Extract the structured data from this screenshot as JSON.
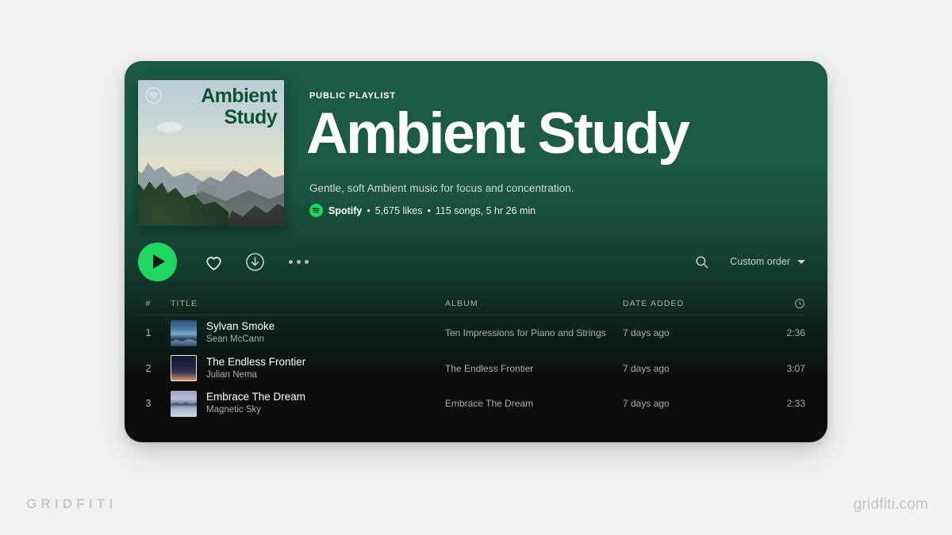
{
  "branding": {
    "left_mark": "GRIDFITI",
    "right_mark": "gridfiti.com"
  },
  "colors": {
    "page_background": "#f2f2f2",
    "header_green": "#1d5a45",
    "body_black": "#0c0c0c",
    "spotify_green": "#1ed760",
    "cover_title_green": "#0f5132"
  },
  "cover": {
    "title_line1": "Ambient",
    "title_line2": "Study",
    "spotify_badge_icon": "spotify-logo-icon",
    "artwork_description": "mountain-landscape-photo"
  },
  "header": {
    "kicker": "PUBLIC PLAYLIST",
    "title": "Ambient Study",
    "description": "Gentle, soft Ambient music for focus and concentration.",
    "owner_icon": "spotify-logo-icon",
    "owner": "Spotify",
    "likes": "5,675 likes",
    "songs_and_duration": "115 songs, 5 hr 26 min",
    "separator": "•"
  },
  "controls": {
    "play_icon": "play-icon",
    "like_icon": "heart-icon",
    "download_icon": "download-circle-icon",
    "more_icon": "more-options-icon",
    "search_icon": "search-icon",
    "sort_label": "Custom order",
    "sort_caret_icon": "chevron-down-icon"
  },
  "table": {
    "headers": {
      "number": "#",
      "title": "TITLE",
      "album": "ALBUM",
      "date_added": "DATE ADDED",
      "duration_icon": "clock-icon"
    },
    "rows": [
      {
        "number": "1",
        "title": "Sylvan Smoke",
        "artist": "Sean McCann",
        "album": "Ten Impressions for Piano and Strings",
        "date_added": "7 days ago",
        "duration": "2:36",
        "thumb_class": "th1"
      },
      {
        "number": "2",
        "title": "The Endless Frontier",
        "artist": "Julian Nema",
        "album": "The Endless Frontier",
        "date_added": "7 days ago",
        "duration": "3:07",
        "thumb_class": "th2"
      },
      {
        "number": "3",
        "title": "Embrace The Dream",
        "artist": "Magnetic Sky",
        "album": "Embrace The Dream",
        "date_added": "7 days ago",
        "duration": "2:33",
        "thumb_class": "th3"
      }
    ]
  }
}
